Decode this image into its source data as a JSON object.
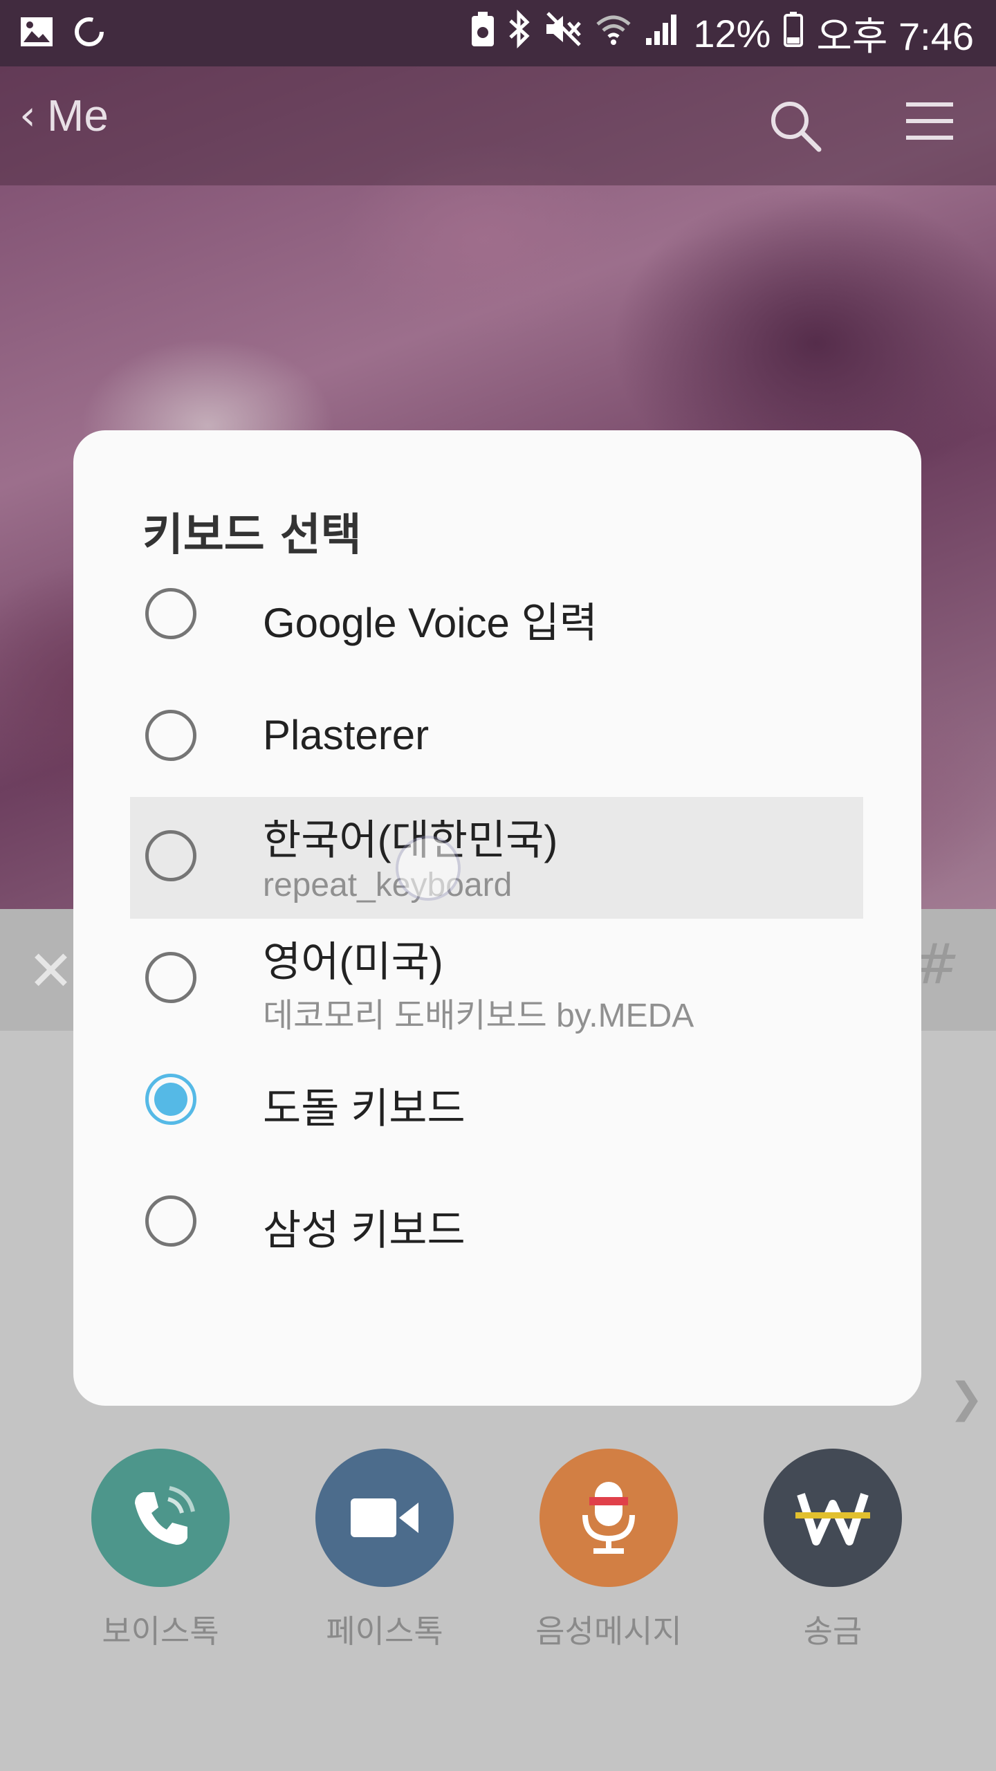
{
  "status_bar": {
    "battery": "12%",
    "time": "오후 7:46",
    "icons": [
      "gallery-icon",
      "sync-icon",
      "battery-saver-icon",
      "bluetooth-icon",
      "mute-icon",
      "wifi-icon",
      "signal-icon",
      "battery-icon"
    ]
  },
  "header": {
    "back_label": "Me",
    "back_icon": "chevron-left-icon",
    "search_icon": "search-icon",
    "menu_icon": "menu-icon"
  },
  "dialog": {
    "title": "키보드 선택",
    "options": [
      {
        "label": "Google Voice 입력",
        "sub": "",
        "checked": false,
        "pressed": false
      },
      {
        "label": "Plasterer",
        "sub": "",
        "checked": false,
        "pressed": false
      },
      {
        "label": "한국어(대한민국)",
        "sub": "repeat_keyboard",
        "checked": false,
        "pressed": true
      },
      {
        "label": "영어(미국)",
        "sub": "데코모리 도배키보드 by.MEDA",
        "checked": false,
        "pressed": false
      },
      {
        "label": "도돌 키보드",
        "sub": "",
        "checked": true,
        "pressed": false
      },
      {
        "label": "삼성 키보드",
        "sub": "",
        "checked": false,
        "pressed": false
      }
    ]
  },
  "actions": [
    {
      "label": "보이스톡",
      "icon": "phone-icon",
      "color": "#4d968b"
    },
    {
      "label": "페이스톡",
      "icon": "video-icon",
      "color": "#4c6c8c"
    },
    {
      "label": "음성메시지",
      "icon": "microphone-icon",
      "color": "#d27f44"
    },
    {
      "label": "송금",
      "icon": "won-icon",
      "color": "#434a55"
    }
  ],
  "colors": {
    "status_bar": "#412b3f",
    "radio_accent": "#55b9e6"
  }
}
